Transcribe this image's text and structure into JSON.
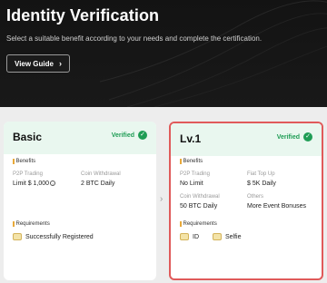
{
  "hero": {
    "title": "Identity Verification",
    "subtitle": "Select a suitable benefit according to your needs and complete the certification.",
    "button_label": "View Guide",
    "button_icon": "chevron-right-icon"
  },
  "colors": {
    "hero_bg": "#151515",
    "verified_green": "#1f9d55",
    "card_head_bg": "#e9f7ef",
    "highlight_border": "#e05a5a",
    "accent_bar": "#e8a93a"
  },
  "cards": [
    {
      "name": "Basic",
      "status": "Verified",
      "benefits_label": "Benefits",
      "benefits": [
        {
          "label": "P2P Trading",
          "value": "Limit $ 1,000"
        },
        {
          "label": "Coin Withdrawal",
          "value": "2 BTC Daily"
        }
      ],
      "requirements_label": "Requirements",
      "requirements": [
        {
          "label": "Successfully Registered",
          "icon": "id-card-icon"
        }
      ]
    },
    {
      "name": "Lv.1",
      "status": "Verified",
      "benefits_label": "Benefits",
      "benefits": [
        {
          "label": "P2P Trading",
          "value": "No Limit"
        },
        {
          "label": "Fiat Top Up",
          "value": "$ 5K Daily"
        },
        {
          "label": "Coin Withdrawal",
          "value": "50 BTC Daily"
        },
        {
          "label": "Others",
          "value": "More Event Bonuses"
        }
      ],
      "requirements_label": "Requirements",
      "requirements": [
        {
          "label": "ID",
          "icon": "id-card-icon"
        },
        {
          "label": "Selfie",
          "icon": "selfie-icon"
        }
      ]
    }
  ]
}
